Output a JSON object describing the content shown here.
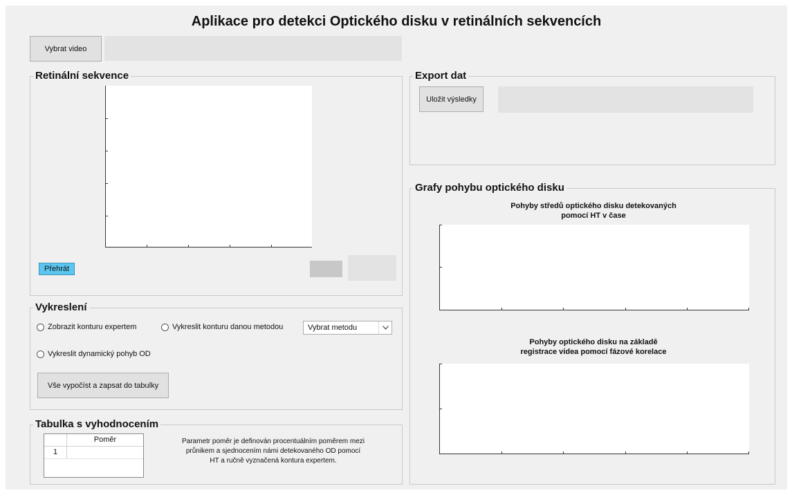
{
  "app": {
    "title": "Aplikace pro detekci Optického disku v retinálních sekvencích"
  },
  "top": {
    "select_video_label": "Vybrat video",
    "video_path_value": ""
  },
  "panels": {
    "retinal": {
      "title": "Retinální sekvence",
      "play_label": "Přehrát",
      "small_indicator_value": "",
      "frame_value": ""
    },
    "drawing": {
      "title": "Vykreslení",
      "radio_expert": "Zobrazit konturu expertem",
      "radio_method": "Vykreslit konturu danou metodou",
      "method_select_value": "Vybrat metodu",
      "radio_dynamic": "Vykreslit dynamický pohyb OD",
      "compute_label": "Vše vypočíst a zapsat do tabulky"
    },
    "table": {
      "title": "Tabulka s vyhodnocením",
      "column_header": "Poměr",
      "rows": [
        {
          "index": "1",
          "value": ""
        }
      ],
      "note_line1": "Parametr poměr je definován procentuálním poměrem mezi",
      "note_line2": "průnikem a sjednocením námi detekovaného OD pomocí",
      "note_line3": "HT a ručně vyznačená kontura expertem."
    },
    "export": {
      "title": "Export dat",
      "save_label": "Uložit výsledky",
      "save_path_value": ""
    },
    "graphs": {
      "title": "Grafy pohybu optického disku",
      "plot1_title_line1": "Pohyby středů optického disku detekovaných",
      "plot1_title_line2": "pomocí HT v čase",
      "plot2_title_line1": "Pohyby optického disku na základě",
      "plot2_title_line2": "registrace videa pomocí fázové korelace"
    }
  },
  "colors": {
    "window_bg": "#f0f0f0",
    "play_button_bg": "#5bc6ef",
    "field_bg": "#e3e3e3"
  },
  "icons": {
    "select_arrow": "chevron-down-icon",
    "radio": "radio-circle-icon"
  }
}
